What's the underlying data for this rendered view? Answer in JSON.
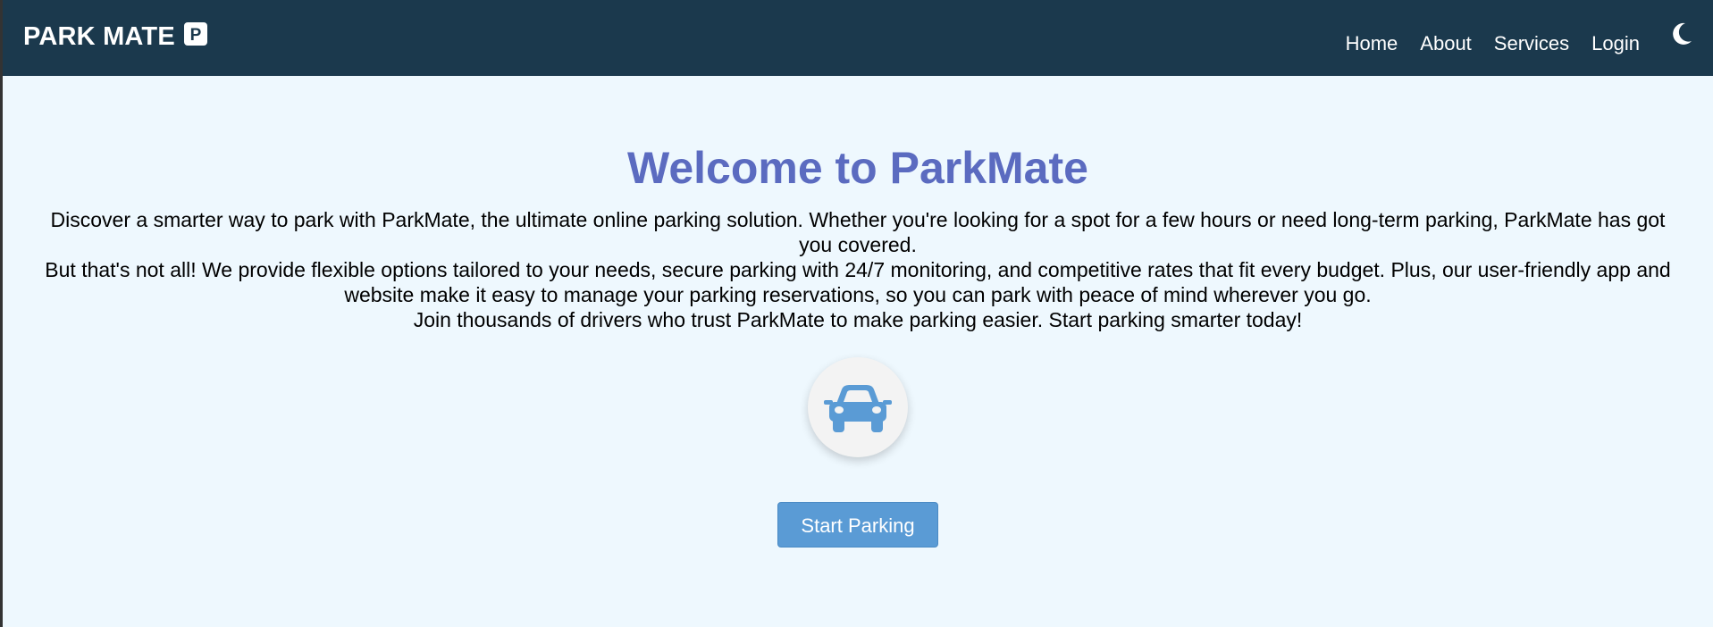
{
  "header": {
    "brand_text": "PARK MATE",
    "brand_logo_letter": "P",
    "nav": [
      {
        "label": "Home"
      },
      {
        "label": "About"
      },
      {
        "label": "Services"
      },
      {
        "label": "Login"
      }
    ],
    "theme_toggle_icon": "moon-icon"
  },
  "hero": {
    "title": "Welcome to ParkMate",
    "paragraphs": [
      "Discover a smarter way to park with ParkMate, the ultimate online parking solution. Whether you're looking for a spot for a few hours or need long-term parking, ParkMate has got you covered.",
      "But that's not all! We provide flexible options tailored to your needs, secure parking with 24/7 monitoring, and competitive rates that fit every budget. Plus, our user-friendly app and website make it easy to manage your parking reservations, so you can park with peace of mind wherever you go.",
      "Join thousands of drivers who trust ParkMate to make parking easier. Start parking smarter today!"
    ],
    "icon": "car-icon",
    "cta_label": "Start Parking"
  },
  "colors": {
    "navbar_bg": "#1b394d",
    "page_bg": "#eef8fe",
    "title_color": "#5b6bc0",
    "accent": "#5a9bd5"
  }
}
